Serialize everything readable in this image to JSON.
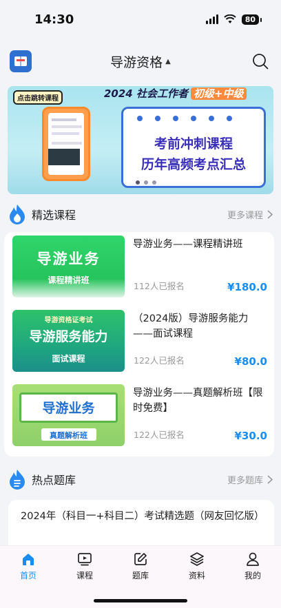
{
  "status_bar": {
    "time": "14:30",
    "battery": "80"
  },
  "header": {
    "title": "导游资格",
    "caret": "▲"
  },
  "banner": {
    "cta": "点击跳转课程",
    "headline": "2024 社会工作者",
    "headline_tag": "初级+中级",
    "board_line1": "考前冲刺课程",
    "board_line2": "历年高频考点汇总"
  },
  "featured": {
    "title": "精选课程",
    "more": "更多课程",
    "courses": [
      {
        "thumb_title": "导游业务",
        "thumb_sub": "课程精讲班",
        "name": "导游业务——课程精讲班",
        "enrolled": "112人已报名",
        "price": "¥180.0"
      },
      {
        "thumb_top": "导游资格证考试",
        "thumb_title": "导游服务能力",
        "thumb_sub": "面试课程",
        "name": "（2024版）导游服务能力——面试课程",
        "enrolled": "122人已报名",
        "price": "¥80.0"
      },
      {
        "thumb_title": "导游业务",
        "thumb_sub": "真题解析班",
        "name": "导游业务——真题解析班【限时免费】",
        "enrolled": "122人已报名",
        "price": "¥30.0"
      }
    ]
  },
  "hot": {
    "title": "热点题库",
    "more": "更多题库",
    "first_item": "2024年（科目一+科目二）考试精选题（网友回忆版）"
  },
  "tabbar": {
    "tabs": [
      {
        "label": "首页",
        "icon": "home-icon"
      },
      {
        "label": "课程",
        "icon": "play-icon"
      },
      {
        "label": "题库",
        "icon": "edit-icon"
      },
      {
        "label": "资料",
        "icon": "layers-icon"
      },
      {
        "label": "我的",
        "icon": "user-icon"
      }
    ],
    "active_color": "#1a8df0"
  }
}
